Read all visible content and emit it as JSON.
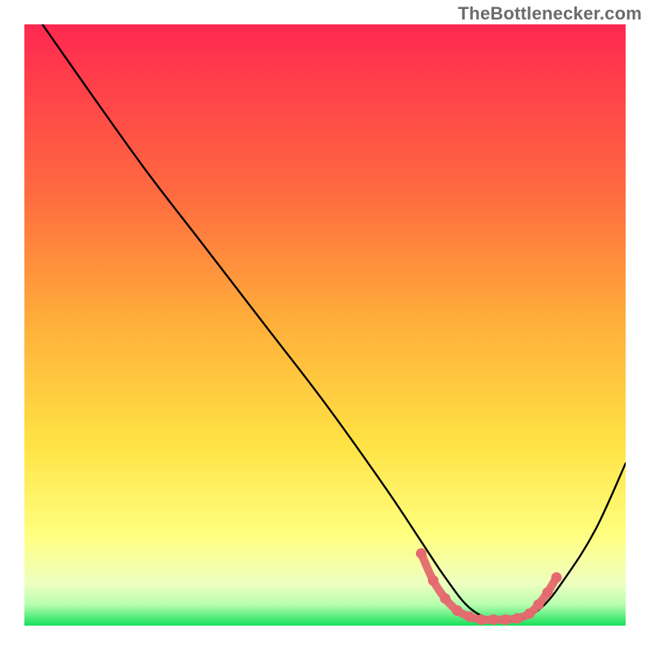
{
  "attribution": "TheBottlenecker.com",
  "colors": {
    "gradient_top": "#ff2850",
    "gradient_mid1": "#ff8a3a",
    "gradient_mid2": "#ffd93a",
    "gradient_mid3": "#ffff66",
    "gradient_low": "#f4ffcf",
    "gradient_bottom": "#15e05a",
    "curve": "#000000",
    "marker": "#e46a6f"
  },
  "chart_data": {
    "type": "line",
    "title": "",
    "xlabel": "",
    "ylabel": "",
    "xlim": [
      0,
      100
    ],
    "ylim": [
      0,
      100
    ],
    "curve": {
      "x": [
        3,
        10,
        20,
        30,
        40,
        50,
        60,
        66,
        70,
        74,
        78,
        82,
        86,
        90,
        95,
        100
      ],
      "y": [
        100,
        90,
        76,
        63,
        50,
        37,
        23,
        14,
        8,
        3,
        1,
        1,
        3,
        8,
        16,
        27
      ]
    },
    "markers": {
      "x": [
        66,
        68,
        70,
        72,
        74,
        76,
        78,
        80,
        82,
        84,
        85.5,
        87,
        88.5
      ],
      "y": [
        12,
        7.5,
        4.5,
        2.5,
        1.5,
        1,
        1,
        1,
        1.2,
        2,
        3.5,
        5.5,
        8
      ]
    },
    "gradient_stops": [
      {
        "offset": 0.0,
        "color": "#ff2850"
      },
      {
        "offset": 0.28,
        "color": "#ff6a40"
      },
      {
        "offset": 0.5,
        "color": "#ffb03a"
      },
      {
        "offset": 0.7,
        "color": "#ffe345"
      },
      {
        "offset": 0.85,
        "color": "#ffff80"
      },
      {
        "offset": 0.93,
        "color": "#eeffc0"
      },
      {
        "offset": 0.965,
        "color": "#b8ffb0"
      },
      {
        "offset": 1.0,
        "color": "#15e05a"
      }
    ]
  }
}
